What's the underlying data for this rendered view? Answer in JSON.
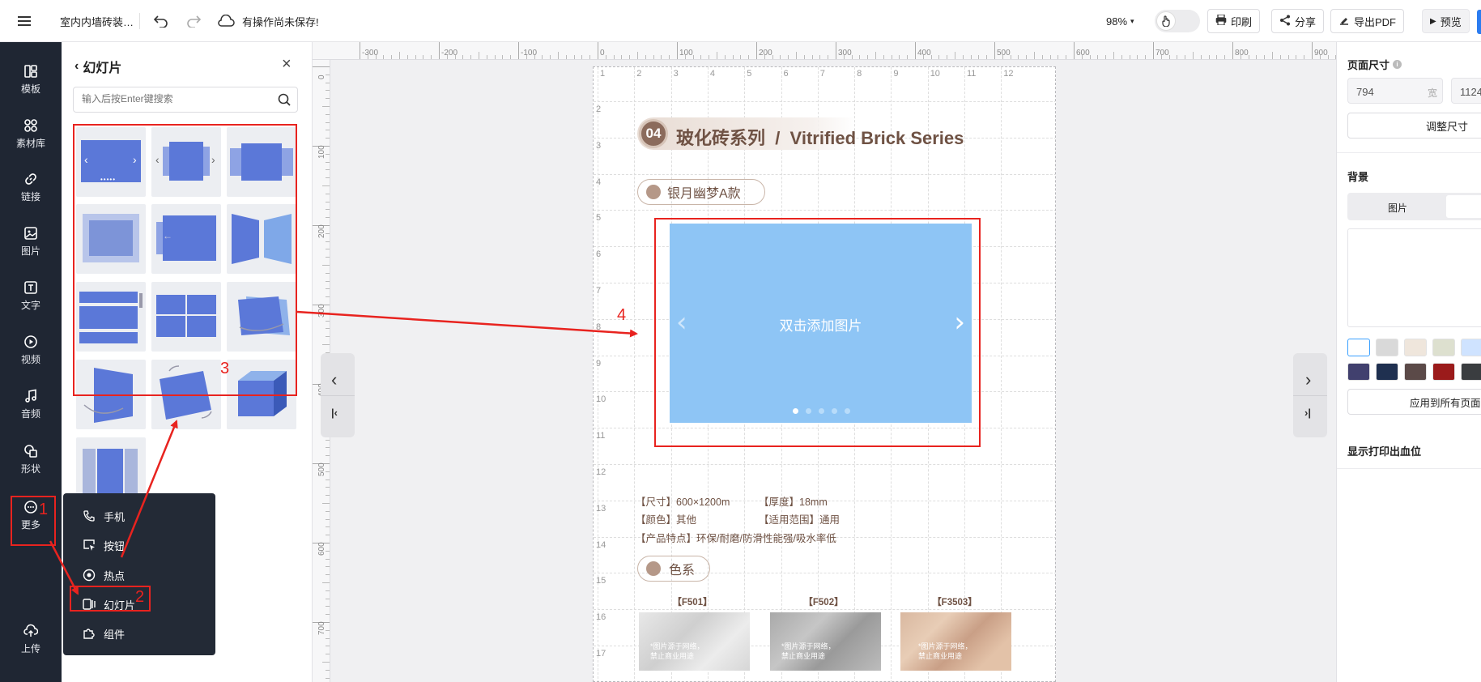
{
  "topbar": {
    "doc_title": "室内内墙砖装…",
    "save_status": "有操作尚未保存!",
    "zoom": "98%",
    "print": "印刷",
    "share": "分享",
    "export_pdf": "导出PDF",
    "preview": "预览"
  },
  "leftbar": {
    "items": [
      {
        "label": "模板"
      },
      {
        "label": "素材库"
      },
      {
        "label": "链接"
      },
      {
        "label": "图片"
      },
      {
        "label": "文字"
      },
      {
        "label": "视频"
      },
      {
        "label": "音频"
      },
      {
        "label": "形状"
      },
      {
        "label": "更多"
      }
    ],
    "upload": "上传"
  },
  "panel": {
    "title": "幻灯片",
    "search_placeholder": "输入后按Enter键搜索"
  },
  "popup": {
    "items": [
      {
        "label": "手机"
      },
      {
        "label": "按钮"
      },
      {
        "label": "热点"
      },
      {
        "label": "幻灯片"
      },
      {
        "label": "组件"
      }
    ]
  },
  "annotations": [
    "1",
    "2",
    "3",
    "4"
  ],
  "ruler": {
    "h_ticks": [
      "-300",
      "-200",
      "-100",
      "0",
      "100",
      "200",
      "300",
      "400",
      "500",
      "600",
      "700",
      "800",
      "900"
    ],
    "v_ticks": [
      "0",
      "100",
      "200",
      "300",
      "400",
      "500",
      "600",
      "700"
    ]
  },
  "page": {
    "col_numbers": [
      "1",
      "2",
      "3",
      "4",
      "5",
      "6",
      "7",
      "8",
      "9",
      "10",
      "11",
      "12"
    ],
    "row_numbers": [
      "2",
      "3",
      "4",
      "5",
      "6",
      "7",
      "8",
      "9",
      "10",
      "11",
      "12",
      "13",
      "14",
      "15",
      "16",
      "17"
    ],
    "section_no": "04",
    "section_title": "玻化砖系列  /  Vitrified Brick Series",
    "tag1": "银月幽梦A款",
    "slideshow_text": "双击添加图片",
    "spec_size": "【尺寸】600×1200m",
    "spec_thickness": "【厚度】18mm",
    "spec_color": "【颜色】其他",
    "spec_scope": "【适用范围】通用",
    "spec_feature": "【产品特点】环保/耐磨/防滑性能强/吸水率低",
    "tag2": "色系",
    "samples": [
      {
        "code": "【F501】",
        "note1": "*图片源于网络，",
        "note2": "禁止商业用途"
      },
      {
        "code": "【F502】",
        "note1": "*图片源于网络，",
        "note2": "禁止商业用途"
      },
      {
        "code": "【F3503】",
        "note1": "*图片源于网络，",
        "note2": "禁止商业用途"
      }
    ]
  },
  "rpanel": {
    "page_size": "页面尺寸",
    "width": "794",
    "width_unit": "宽",
    "height": "1124",
    "adjust": "调整尺寸",
    "background": "背景",
    "tab_image": "图片",
    "apply_all": "应用到所有页面",
    "bleed": "显示打印出血位"
  },
  "colors": {
    "accent_red": "#e8231f",
    "slideshow_blue": "#8ec5f5",
    "brown": "#7a5a48"
  }
}
